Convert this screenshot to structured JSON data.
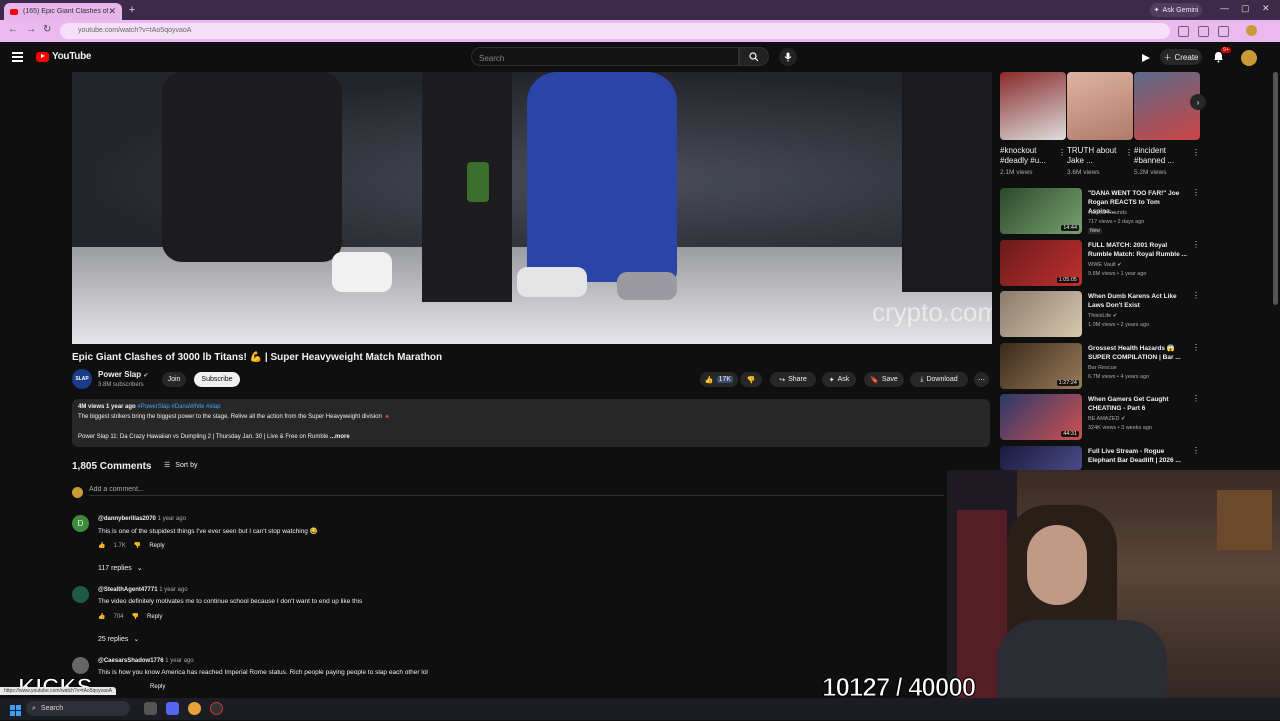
{
  "browser": {
    "tab_title": "(165) Epic Giant Clashes of",
    "new_tab_symbol": "+",
    "url": "youtube.com/watch?v=tAo5qoyvaoA",
    "ask_gemini": "Ask Gemini",
    "profile_badge": "9+"
  },
  "header": {
    "logo_text": "YouTube",
    "search_placeholder": "Search",
    "create_label": "Create",
    "notif_badge": "9+"
  },
  "video": {
    "watermark": "crypto.com",
    "title": "Epic Giant Clashes of 3000 lb Titans! 💪 | Super Heavyweight Match Marathon"
  },
  "channel": {
    "avatar_text": "SLAP",
    "name": "Power Slap",
    "subscribers": "3.8M subscribers",
    "join_label": "Join",
    "subscribe_label": "Subscribe"
  },
  "actions": {
    "like_count": "17K",
    "share_label": "Share",
    "ask_label": "Ask",
    "save_label": "Save",
    "download_label": "Download"
  },
  "description": {
    "stats": "4M views  1 year ago",
    "tags": "#PowerSlap #DanaWhite #slap",
    "line1": "The biggest strikers bring the biggest power to the stage. Relive all the action from the Super Heavyweight division 🔺",
    "line2": "Power Slap 11: Da Crazy Hawaiian vs Dumpling 2 | Thursday Jan. 30 | Live & Free on Rumble",
    "more": "...more"
  },
  "comments_section": {
    "count_label": "1,805 Comments",
    "sort_label": "Sort by",
    "add_placeholder": "Add a comment..."
  },
  "comments": [
    {
      "avatar": "D",
      "avatar_color": "#3c8c3c",
      "author": "@dannyberillas2070",
      "time": "1 year ago",
      "text": "This is one of the stupidest things I've ever seen but I can't stop watching 😂",
      "likes": "1.7K",
      "reply": "Reply",
      "replies": "117 replies"
    },
    {
      "avatar": "",
      "avatar_color": "#1f5a45",
      "author": "@StealthAgent47771",
      "time": "1 year ago",
      "text": "The video definitely motivates me to continue school because I don't want to end up like this",
      "likes": "704",
      "reply": "Reply",
      "replies": "25 replies"
    },
    {
      "avatar": "",
      "avatar_color": "#666666",
      "author": "@CaesarsShadow1776",
      "time": "1 year ago",
      "text": "This is how you know America has reached Imperial Rome status. Rich people paying people to slap each other lol",
      "likes": "",
      "reply": "Reply",
      "replies": ""
    }
  ],
  "shorts": [
    {
      "title": "#knockout #deadly #u...",
      "views": "2.1M views",
      "color": "#8a2a2a"
    },
    {
      "title": "TRUTH about Jake ...",
      "views": "3.6M views",
      "color": "#b07a6a"
    },
    {
      "title": "#incident #banned ...",
      "views": "5.2M views",
      "color": "#5a6a8a"
    }
  ],
  "recommendations": [
    {
      "title": "\"DANA WENT TOO FAR!\" Joe Rogan REACTS to Tom Aspina...",
      "channel": "Tactical Rounds",
      "meta": "717 views • 2 days ago",
      "duration": "14:44",
      "badge": "New",
      "color": "#2a4a2a"
    },
    {
      "title": "FULL MATCH: 2001 Royal Rumble Match: Royal Rumble ...",
      "channel": "WWE Vault ✔",
      "meta": "9.8M views • 1 year ago",
      "duration": "1:05:05",
      "badge": "",
      "color": "#6a1a1a"
    },
    {
      "title": "When Dumb Karens Act Like Laws Don't Exist",
      "channel": "ThisisLife ✔",
      "meta": "1.0M views • 2 years ago",
      "duration": "",
      "badge": "",
      "color": "#4a4a3a"
    },
    {
      "title": "Grossest Health Hazards 😱 SUPER COMPILATION | Bar ...",
      "channel": "Bar Rescue",
      "meta": "6.7M views • 4 years ago",
      "duration": "1:27:24",
      "badge": "",
      "color": "#3a2a1a"
    },
    {
      "title": "When Gamers Get Caught CHEATING - Part 6",
      "channel": "BE AMAZED ✔",
      "meta": "324K views • 3 weeks ago",
      "duration": "44:31",
      "badge": "",
      "color": "#2a3a6a"
    },
    {
      "title": "Full Live Stream - Rogue Elephant Bar Deadlift | 2026 ...",
      "channel": "",
      "meta": "",
      "duration": "",
      "badge": "",
      "color": "#1a1a3a"
    }
  ],
  "overlay": {
    "counter": "10127 / 40000",
    "kicks": "KICKS",
    "status_url": "https://www.youtube.com/watch?v=tAo5qoyvaoA"
  },
  "taskbar": {
    "search_label": "Search"
  }
}
